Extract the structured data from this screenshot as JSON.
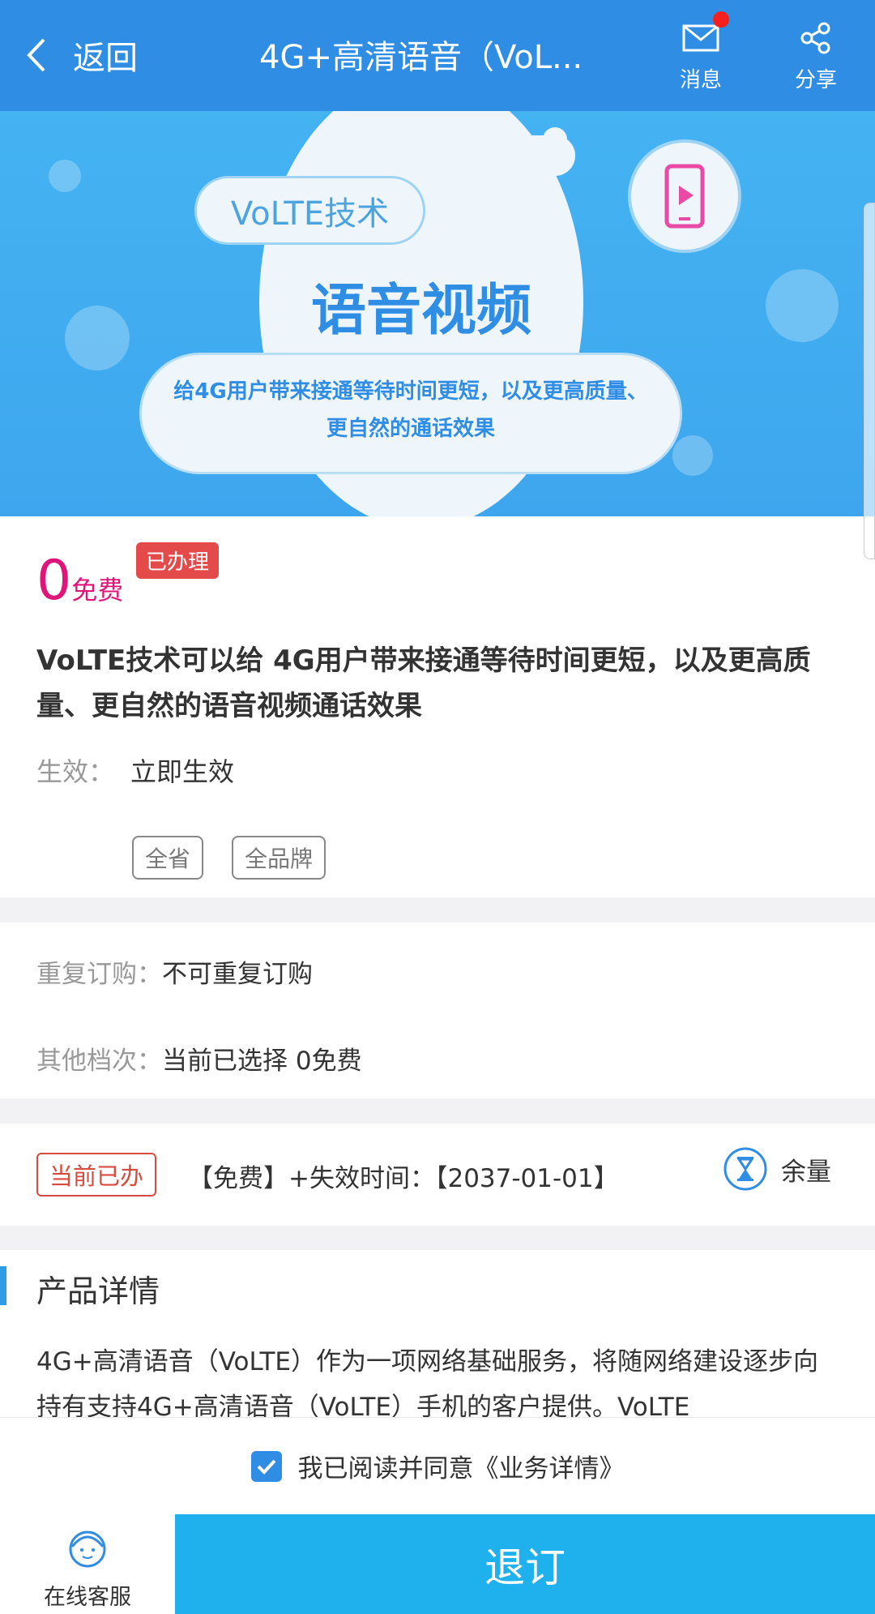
{
  "header": {
    "back_label": "返回",
    "title": "4G+高清语音（VoL...",
    "message_label": "消息",
    "share_label": "分享",
    "accent": "#2f8de4"
  },
  "banner": {
    "pill_text": "VoLTE技术",
    "main_text": "语音视频",
    "sub_line1": "给4G用户带来接通等待时间更短，以及更高质量、",
    "sub_line2": "更自然的通话效果"
  },
  "plan": {
    "price_num": "0",
    "price_text": "免费",
    "status_badge": "已办理",
    "description": "VoLTE技术可以给 4G用户带来接通等待时间更短，以及更高质量、更自然的语音视频通话效果",
    "effective_label": "生效：",
    "effective_value": "立即生效",
    "tags": [
      "全省",
      "全品牌"
    ]
  },
  "options": {
    "repeat_label": "重复订购：",
    "repeat_value": "不可重复订购",
    "other_label": "其他档次：",
    "other_value": "当前已选择 0免费"
  },
  "current": {
    "badge": "当前已办",
    "text": "【免费】+失效时间：【2037-01-01】",
    "remain_label": "余量"
  },
  "details": {
    "title": "产品详情",
    "text": "4G+高清语音（VoLTE）作为一项网络基础服务，将随网络建设逐步向持有支持4G+高清语音（VoLTE）手机的客户提供。VoLTE"
  },
  "agreement": {
    "checked": true,
    "text": "我已阅读并同意《业务详情》"
  },
  "footer": {
    "service_label": "在线客服",
    "action_label": "退订"
  }
}
